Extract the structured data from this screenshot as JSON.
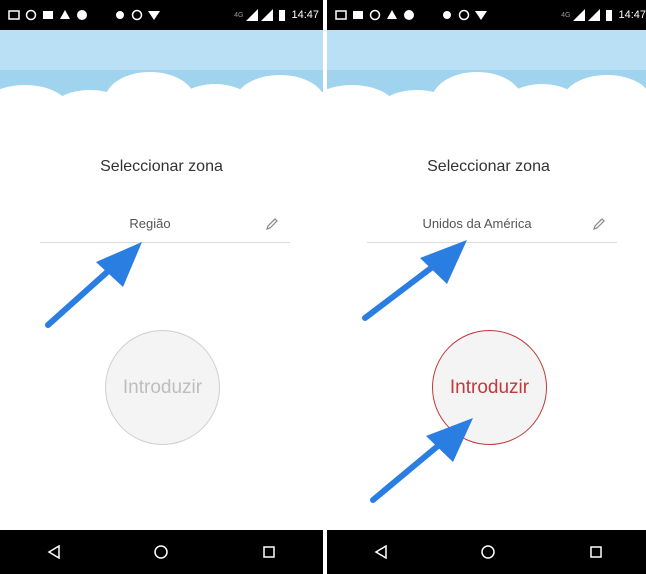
{
  "status_bar": {
    "time": "14:47",
    "network": "4G"
  },
  "screens": [
    {
      "title": "Seleccionar zona",
      "region_value": "Região",
      "enter_button_label": "Introduzir",
      "enter_button_state": "disabled"
    },
    {
      "title": "Seleccionar zona",
      "region_value": "Unidos da América",
      "enter_button_label": "Introduzir",
      "enter_button_state": "enabled"
    }
  ],
  "nav_bar": {
    "icons": [
      "back-icon",
      "home-icon",
      "recents-icon"
    ]
  },
  "colors": {
    "active_accent": "#c0393b",
    "arrow": "#2a7de1",
    "sky": "#9fd3ee"
  }
}
